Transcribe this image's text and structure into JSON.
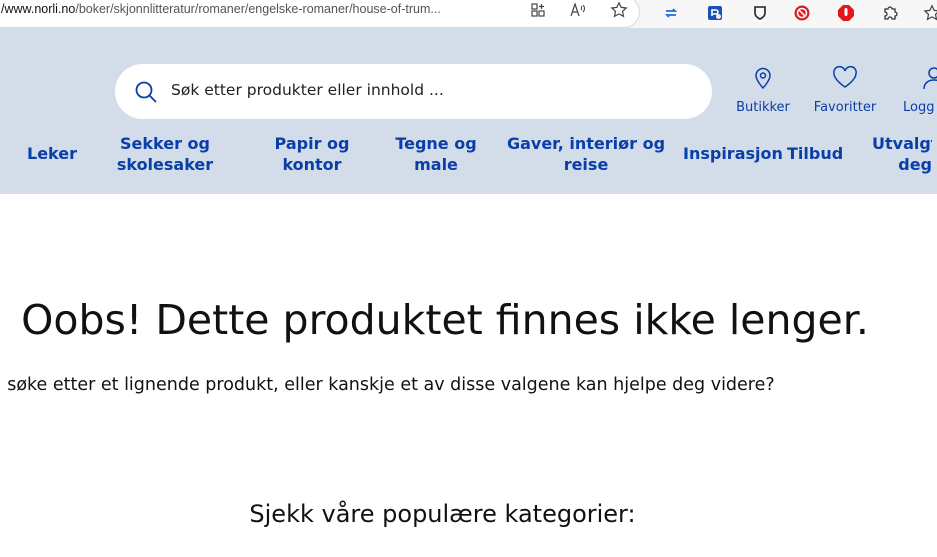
{
  "browser": {
    "url_host": "/www.norli.no",
    "url_path": "/boker/skjonnlitteratur/romaner/engelske-romaner/house-of-trum..."
  },
  "header": {
    "search": {
      "placeholder": "Søk etter produkter eller innhold ..."
    },
    "actions": [
      {
        "label": "Butikker",
        "icon": "map-pin-icon"
      },
      {
        "label": "Favoritter",
        "icon": "heart-icon"
      },
      {
        "label": "Logg",
        "icon": "user-icon"
      }
    ],
    "nav": [
      {
        "label": "Leker"
      },
      {
        "line1": "Sekker og",
        "line2": "skolesaker"
      },
      {
        "line1": "Papir og",
        "line2": "kontor"
      },
      {
        "line1": "Tegne og",
        "line2": "male"
      },
      {
        "line1": "Gaver, interiør og",
        "line2": "reise"
      },
      {
        "label": "Inspirasjon"
      },
      {
        "label": "Tilbud"
      },
      {
        "line1": "Utvalgt",
        "line2": "deg"
      }
    ]
  },
  "main": {
    "title": "Oobs! Dette produktet finnes ikke lenger.",
    "subtitle": "v å søke etter et lignende produkt, eller kanskje et av disse valgene kan hjelpe deg videre?",
    "categories_heading": "Sjekk våre populære kategorier:"
  },
  "colors": {
    "header_bg": "#d3dde9",
    "brand_blue": "#0a3ea8"
  }
}
